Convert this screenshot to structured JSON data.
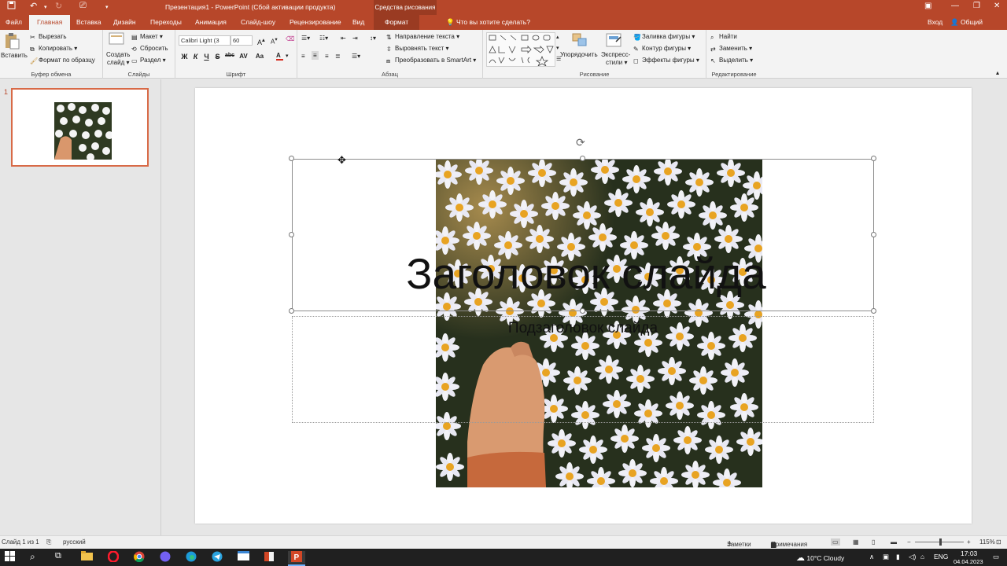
{
  "window": {
    "title": "Презентация1 - PowerPoint (Сбой активации продукта)",
    "tools_tab": "Средства рисования",
    "login": "Вход",
    "share": "Общий доступ"
  },
  "tabs": [
    "Файл",
    "Главная",
    "Вставка",
    "Дизайн",
    "Переходы",
    "Анимация",
    "Слайд-шоу",
    "Рецензирование",
    "Вид"
  ],
  "context_tab": "Формат",
  "tell_me": "Что вы хотите сделать?",
  "ribbon": {
    "clipboard": {
      "paste": "Вставить",
      "cut": "Вырезать",
      "copy": "Копировать",
      "format_painter": "Формат по образцу",
      "label": "Буфер обмена"
    },
    "slides": {
      "new_slide_1": "Создать",
      "new_slide_2": "слайд",
      "layout": "Макет",
      "reset": "Сбросить",
      "section": "Раздел",
      "label": "Слайды"
    },
    "font": {
      "name": "Calibri Light (З",
      "size": "60",
      "bold": "Ж",
      "italic": "К",
      "underline": "Ч",
      "strike": "S",
      "strike_abc": "abc",
      "spacing": "AV",
      "case": "Aa",
      "label": "Шрифт"
    },
    "paragraph": {
      "direction": "Направление текста",
      "align": "Выровнять текст",
      "smartart": "Преобразовать в SmartArt",
      "label": "Абзац"
    },
    "drawing": {
      "arrange": "Упорядочить",
      "styles_1": "Экспресс-",
      "styles_2": "стили",
      "fill": "Заливка фигуры",
      "outline": "Контур фигуры",
      "effects": "Эффекты фигуры",
      "label": "Рисование"
    },
    "editing": {
      "find": "Найти",
      "replace": "Заменить",
      "select": "Выделить",
      "label": "Редактирование"
    }
  },
  "thumbnail_number": "1",
  "slide": {
    "title": "Заголовок слайда",
    "subtitle": "Подзаголовок слайда"
  },
  "status": {
    "slide_count": "Слайд 1 из 1",
    "language": "русский",
    "notes": "Заметки",
    "comments": "Примечания",
    "zoom": "115%"
  },
  "taskbar": {
    "weather": "10°C  Cloudy",
    "lang": "ENG",
    "time": "17:03",
    "date": "04.04.2023"
  }
}
